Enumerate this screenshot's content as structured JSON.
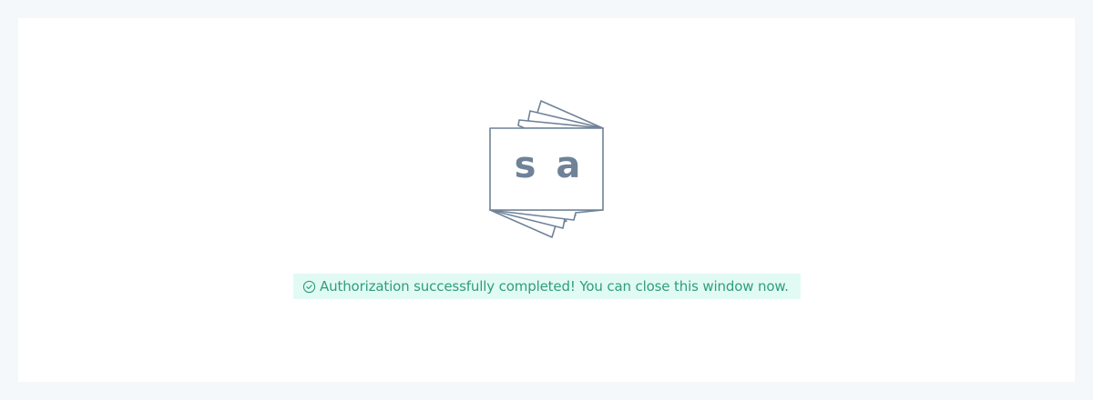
{
  "logo": {
    "letters": [
      "s",
      "a"
    ],
    "color": "#6f8298",
    "icon": "stacked-cards-logo"
  },
  "alert": {
    "icon": "check-circle-icon",
    "message": "Authorization successfully completed! You can close this window now.",
    "text_color": "#2f9e7b",
    "background": "#e2faf4"
  },
  "colors": {
    "page_background": "#f5f8fb",
    "card_background": "#ffffff"
  }
}
